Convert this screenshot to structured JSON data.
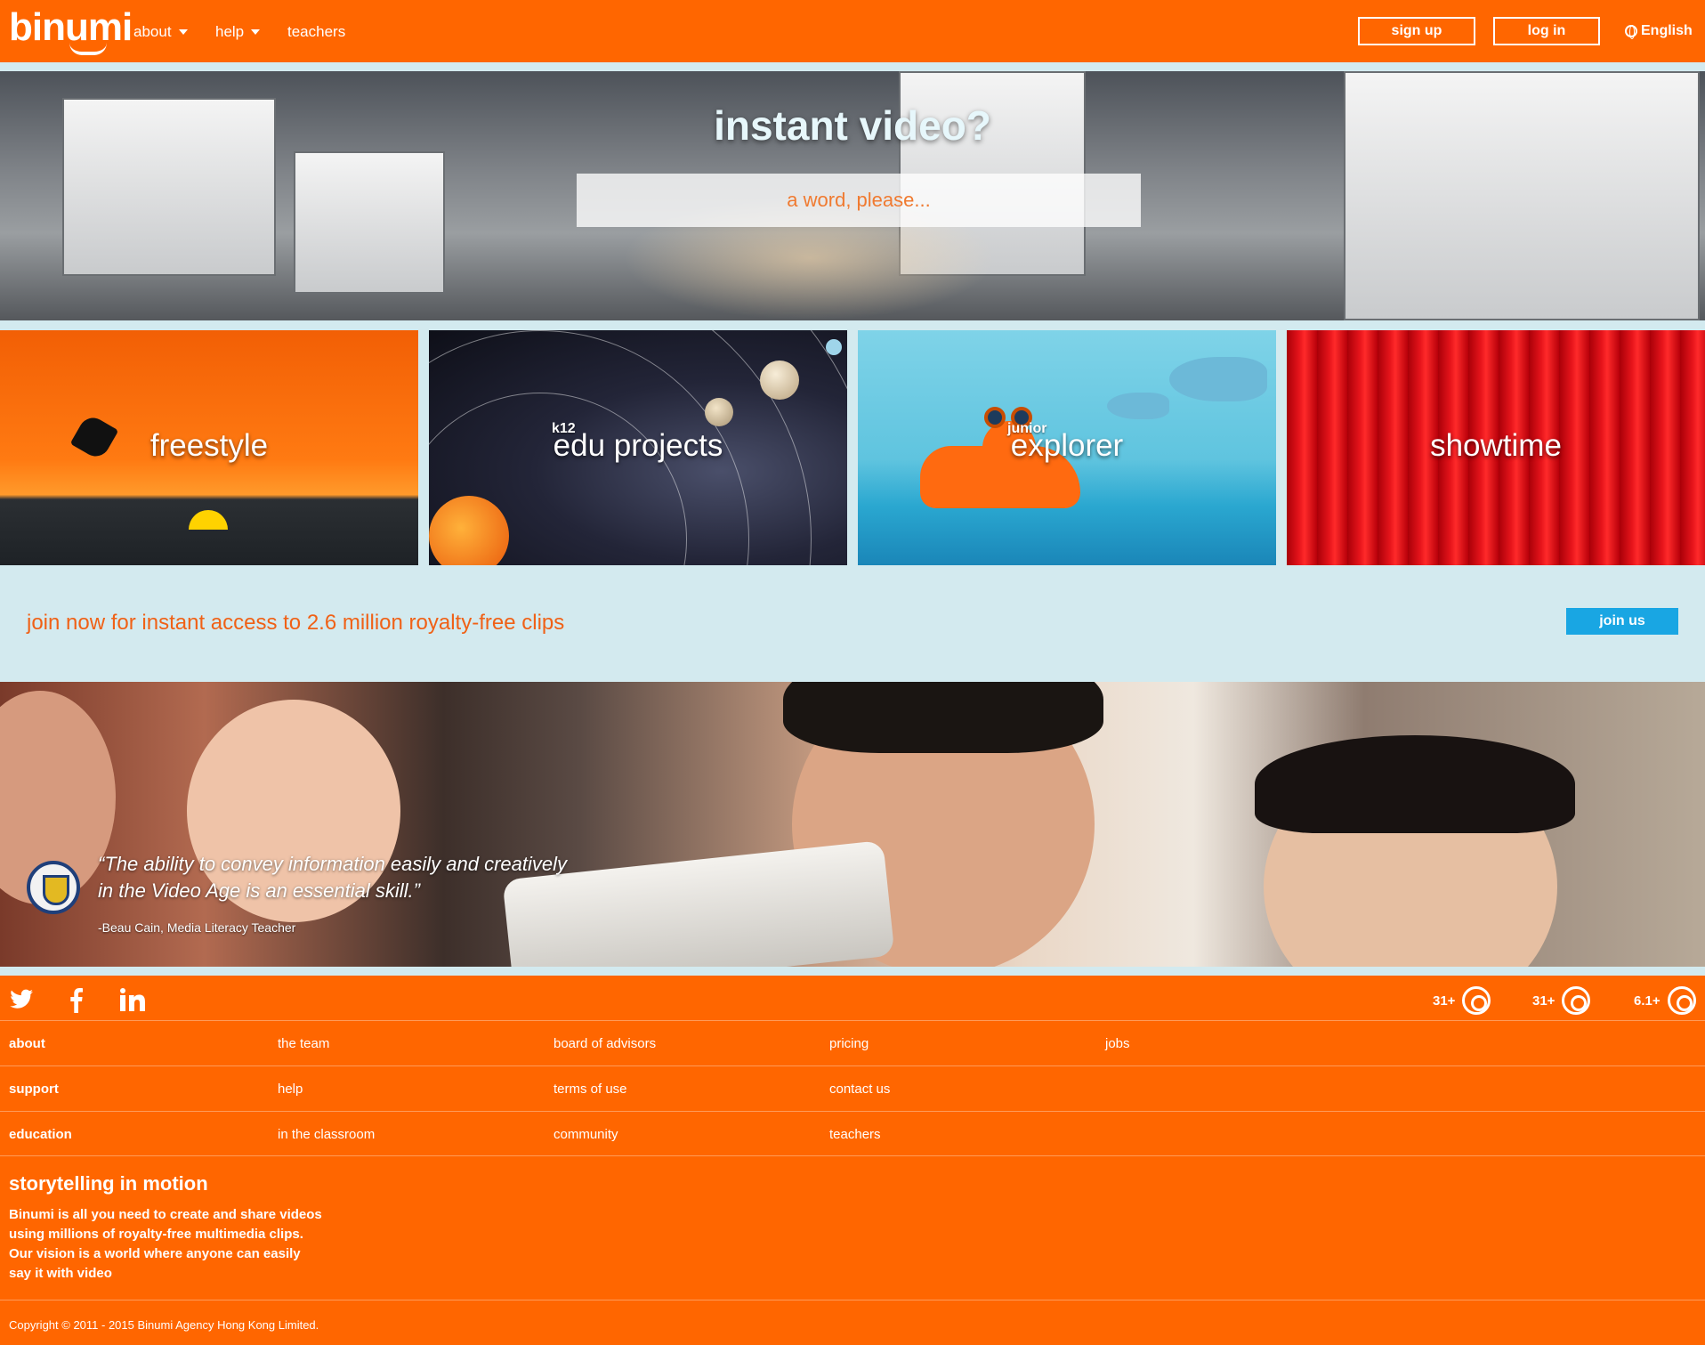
{
  "header": {
    "logo": "binumi",
    "nav": [
      {
        "label": "about",
        "has_caret": true
      },
      {
        "label": "help",
        "has_caret": true
      },
      {
        "label": "teachers",
        "has_caret": false
      }
    ],
    "signup_label": "sign up",
    "login_label": "log in",
    "language": "English"
  },
  "hero": {
    "title": "instant video?",
    "search_placeholder": "a word, please..."
  },
  "tiles": [
    {
      "label": "freestyle",
      "sub": ""
    },
    {
      "label": "edu projects",
      "sub": "k12"
    },
    {
      "label": "explorer",
      "sub": "junior"
    },
    {
      "label": "showtime",
      "sub": ""
    }
  ],
  "join": {
    "text": "join now for instant access to 2.6 million royalty-free clips",
    "button": "join us"
  },
  "testimonial": {
    "quote_line1": "“The ability to convey information easily and creatively",
    "quote_line2": "in the Video Age is an essential skill.”",
    "author": "-Beau Cain, Media Literacy Teacher"
  },
  "footer": {
    "social": [
      "twitter-icon",
      "facebook-icon",
      "linkedin-icon"
    ],
    "browsers": [
      {
        "version": "31+",
        "icon": "chrome-icon"
      },
      {
        "version": "31+",
        "icon": "firefox-icon"
      },
      {
        "version": "6.1+",
        "icon": "safari-icon"
      }
    ],
    "rows": [
      [
        "about",
        "the team",
        "board of advisors",
        "pricing",
        "jobs"
      ],
      [
        "support",
        "help",
        "terms of use",
        "contact us"
      ],
      [
        "education",
        "in the classroom",
        "community",
        "teachers"
      ]
    ],
    "tagline_title": "storytelling in motion",
    "tagline_lines": [
      "Binumi is all you need to create and share videos",
      "using millions of royalty-free multimedia clips.",
      "Our vision is a world where anyone can easily",
      "say it with video"
    ],
    "copyright": "Copyright © 2011 - 2015 Binumi Agency Hong Kong Limited."
  },
  "colors": {
    "brand_orange": "#ff6600",
    "page_bg": "#d3eaef",
    "join_button": "#19a6e3"
  }
}
